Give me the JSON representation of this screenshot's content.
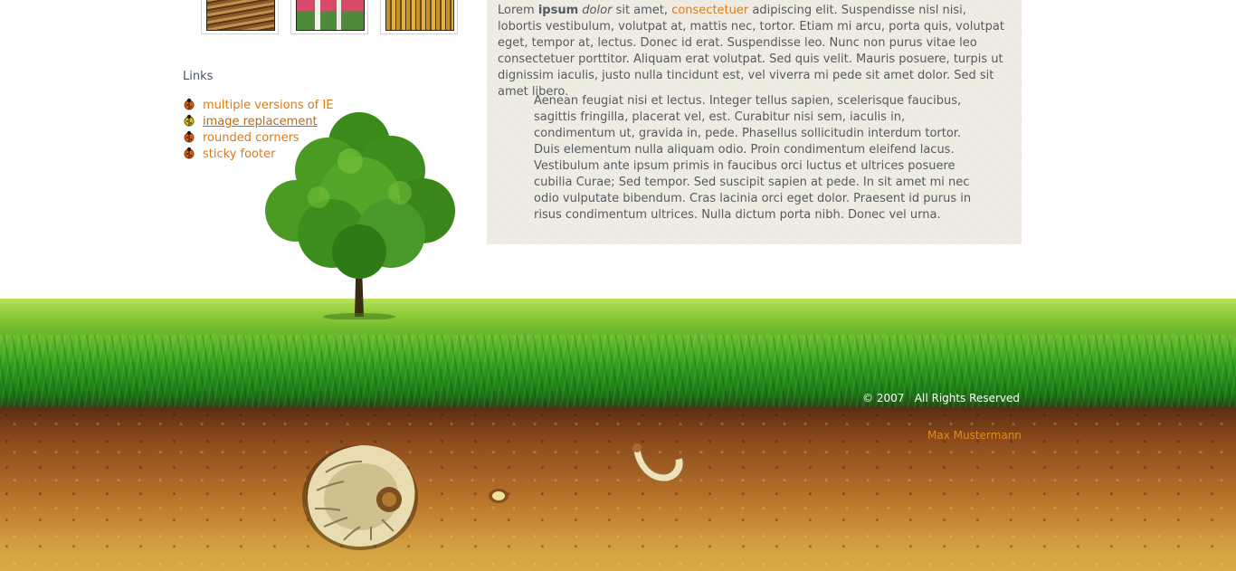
{
  "sidebar": {
    "links_heading": "Links",
    "links": [
      {
        "label": "multiple versions of IE",
        "icon": "ladybug-icon"
      },
      {
        "label": "image replacement",
        "icon": "ladybug-icon",
        "active": true
      },
      {
        "label": "rounded corners",
        "icon": "ladybug-icon"
      },
      {
        "label": "sticky footer",
        "icon": "ladybug-icon"
      }
    ]
  },
  "content": {
    "p1": {
      "w1": "Lorem",
      "w2": "ipsum",
      "w3": "dolor",
      "w4": "sit amet,",
      "link": "consectetuer",
      "rest": "adipiscing elit. Suspendisse nisl nisi, lobortis vestibulum, volutpat at, mattis nec, tortor. Etiam mi arcu, porta quis, volutpat eget, tempor at, lectus. Donec id erat. Suspendisse leo. Nunc non purus vitae leo consectetuer porttitor. Aliquam erat volutpat. Sed quis velit. Mauris posuere, turpis ut dignissim iaculis, justo nulla tincidunt est, vel viverra mi pede sit amet dolor. Sed sit amet libero."
    },
    "blockquote": "Aenean feugiat nisi et lectus. Integer tellus sapien, scelerisque faucibus, sagittis fringilla, placerat vel, est. Curabitur nisi sem, iaculis in, condimentum ut, gravida in, pede. Phasellus sollicitudin interdum tortor. Duis elementum nulla aliquam odio. Proin condimentum eleifend lacus. Vestibulum ante ipsum primis in faucibus orci luctus et ultrices posuere cubilia Curae; Sed tempor. Sed suscipit sapien at pede. In sit amet mi nec odio vulputate bibendum. Cras lacinia orci eget dolor. Praesent id purus in risus condimentum ultrices. Nulla dictum porta nibh. Donec vel urna."
  },
  "footer": {
    "copyright": "© 2007   All Rights Reserved",
    "author": "Max Mustermann"
  },
  "colors": {
    "link": "#e07a10",
    "text": "#555a5e",
    "panel": "#f0ede4"
  }
}
